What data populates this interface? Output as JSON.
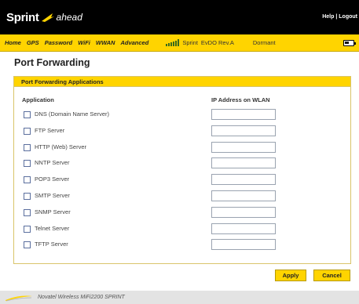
{
  "header": {
    "brand": "Sprint",
    "tagline": "ahead",
    "help": "Help",
    "separator": "|",
    "logout": "Logout"
  },
  "nav": {
    "items": [
      "Home",
      "GPS",
      "Password",
      "WiFi",
      "WWAN",
      "Advanced"
    ],
    "carrier": "Sprint",
    "network": "EvDO Rev.A",
    "state": "Dormant"
  },
  "page": {
    "title": "Port Forwarding"
  },
  "panel": {
    "title": "Port Forwarding Applications",
    "col_application": "Application",
    "col_ip": "IP Address on WLAN",
    "services": [
      {
        "label": "DNS (Domain Name Server)",
        "checked": false,
        "ip": ""
      },
      {
        "label": "FTP Server",
        "checked": false,
        "ip": ""
      },
      {
        "label": "HTTP (Web) Server",
        "checked": false,
        "ip": ""
      },
      {
        "label": "NNTP Server",
        "checked": false,
        "ip": ""
      },
      {
        "label": "POP3 Server",
        "checked": false,
        "ip": ""
      },
      {
        "label": "SMTP Server",
        "checked": false,
        "ip": ""
      },
      {
        "label": "SNMP Server",
        "checked": false,
        "ip": ""
      },
      {
        "label": "Telnet Server",
        "checked": false,
        "ip": ""
      },
      {
        "label": "TFTP Server",
        "checked": false,
        "ip": ""
      }
    ]
  },
  "buttons": {
    "apply": "Apply",
    "cancel": "Cancel"
  },
  "footer": {
    "text": "Novatel Wireless MiFi2200 SPRINT"
  },
  "colors": {
    "accent": "#ffd400",
    "header_bg": "#000000"
  }
}
